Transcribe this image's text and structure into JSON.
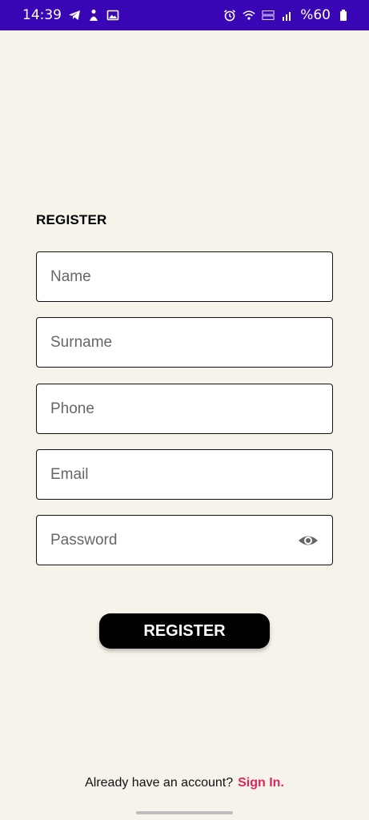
{
  "status_bar": {
    "time": "14:39",
    "battery": "%60",
    "background": "#3a06b5",
    "left_icons": [
      "telegram-icon",
      "figure-icon",
      "image-icon"
    ],
    "right_icons": [
      "alarm-icon",
      "wifi-icon",
      "volte-icon",
      "signal-icon",
      "battery-icon"
    ]
  },
  "form": {
    "title": "REGISTER",
    "fields": {
      "name": "Name",
      "surname": "Surname",
      "phone": "Phone",
      "email": "Email",
      "password": "Password"
    },
    "submit_label": "REGISTER"
  },
  "footer": {
    "prompt": "Already have an account?",
    "link": "Sign In.",
    "link_color": "#e0245e"
  }
}
